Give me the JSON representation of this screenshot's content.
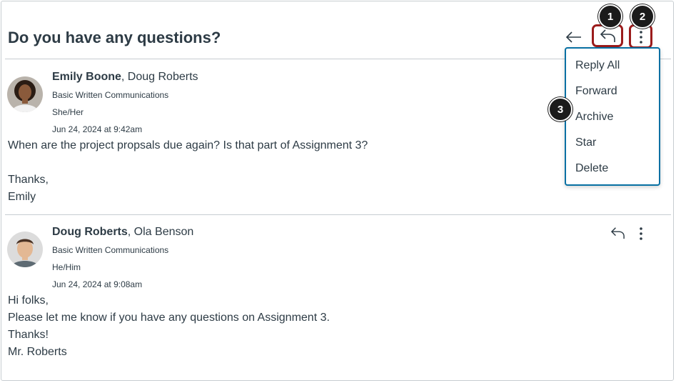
{
  "conversation": {
    "title": "Do you have any questions?"
  },
  "callouts": [
    "1",
    "2",
    "3"
  ],
  "menu": {
    "items": [
      "Reply All",
      "Forward",
      "Archive",
      "Star",
      "Delete"
    ]
  },
  "messages": [
    {
      "sender": "Emily Boone",
      "recipients": ", Doug Roberts",
      "course": "Basic Written Communications",
      "pronouns": "She/Her",
      "date": "Jun 24, 2024 at 9:42am",
      "body": [
        "When are the project propsals due again? Is that part of Assignment 3?",
        "Thanks,",
        "Emily"
      ]
    },
    {
      "sender": "Doug Roberts",
      "recipients": ", Ola Benson",
      "course": "Basic Written Communications",
      "pronouns": "He/Him",
      "date": "Jun 24, 2024 at 9:08am",
      "body": [
        "Hi folks,",
        "Please let me know if you have any questions on Assignment 3.",
        "Thanks!",
        "Mr. Roberts"
      ]
    }
  ],
  "icons": {
    "back": "arrow-left-icon",
    "reply": "reply-icon",
    "more": "more-vertical-icon"
  },
  "colors": {
    "callout_outline": "#9b1c1c",
    "menu_border": "#0770a3",
    "text": "#2d3b45"
  }
}
